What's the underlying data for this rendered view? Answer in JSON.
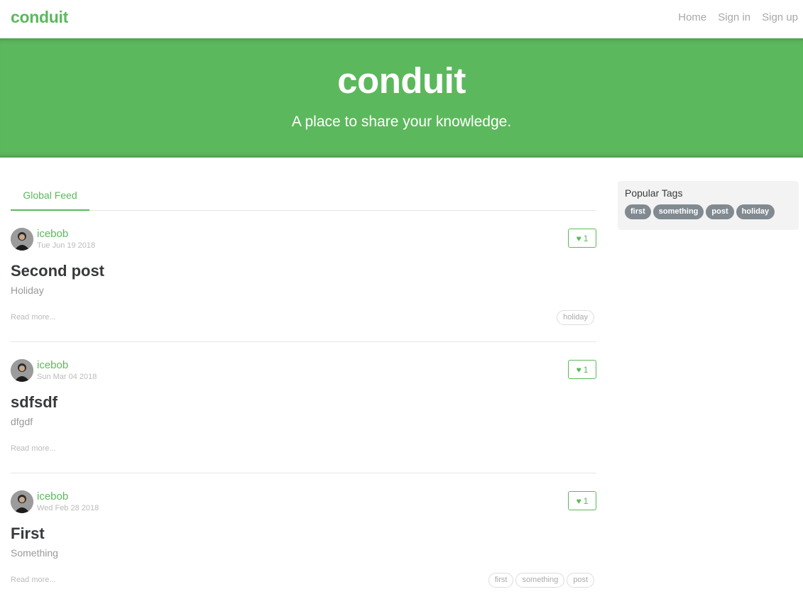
{
  "nav": {
    "brand": "conduit",
    "links": [
      "Home",
      "Sign in",
      "Sign up"
    ]
  },
  "banner": {
    "title": "conduit",
    "subtitle": "A place to share your knowledge."
  },
  "feed": {
    "tab": "Global Feed"
  },
  "articles": [
    {
      "author": "icebob",
      "date": "Tue Jun 19 2018",
      "favorites": "1",
      "title": "Second post",
      "description": "Holiday",
      "read_more": "Read more...",
      "tags": [
        "holiday"
      ]
    },
    {
      "author": "icebob",
      "date": "Sun Mar 04 2018",
      "favorites": "1",
      "title": "sdfsdf",
      "description": "dfgdf",
      "read_more": "Read more...",
      "tags": []
    },
    {
      "author": "icebob",
      "date": "Wed Feb 28 2018",
      "favorites": "1",
      "title": "First",
      "description": "Something",
      "read_more": "Read more...",
      "tags": [
        "first",
        "something",
        "post"
      ]
    }
  ],
  "sidebar": {
    "title": "Popular Tags",
    "tags": [
      "first",
      "something",
      "post",
      "holiday"
    ]
  },
  "colors": {
    "brand": "#5cb85c",
    "tag_pill": "#818a91"
  }
}
